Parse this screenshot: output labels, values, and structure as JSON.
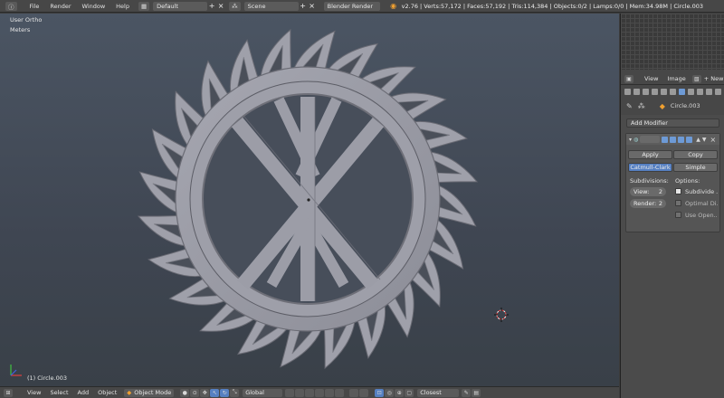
{
  "top_bar": {
    "menus": [
      "File",
      "Render",
      "Window",
      "Help"
    ],
    "screen_layout": "Default",
    "scene": "Scene",
    "render_engine": "Blender Render",
    "stats": "v2.76 | Verts:57,172 | Faces:57,192 | Tris:114,384 | Objects:0/2 | Lamps:0/0 | Mem:34.98M | Circle.003"
  },
  "viewport": {
    "view_name": "User Ortho",
    "units": "Meters",
    "selected_object_label": "(1) Circle.003",
    "axis_labels": {
      "x": "x",
      "y": "y",
      "z": "z"
    }
  },
  "bottom_bar": {
    "menus": [
      "View",
      "Select",
      "Add",
      "Object"
    ],
    "mode": "Object Mode",
    "transform_orientation": "Global",
    "snap_element": "Closest"
  },
  "uv_header": {
    "menus": [
      "View",
      "Image"
    ],
    "new_button": "New"
  },
  "properties": {
    "object_name": "Circle.003",
    "add_modifier": "Add Modifier",
    "modifier": {
      "apply": "Apply",
      "copy": "Copy",
      "type_catmull": "Catmull-Clark",
      "type_simple": "Simple",
      "subdivisions_label": "Subdivisions:",
      "options_label": "Options:",
      "view_label": "View:",
      "view_value": "2",
      "render_label": "Render:",
      "render_value": "2",
      "subdivide_uvs": "Subdivide ...",
      "optimal_display": "Optimal Di...",
      "use_opensubdiv": "Use Open..."
    }
  },
  "colors": {
    "accent": "#5680c2",
    "mesh": "#9b9ca6",
    "viewport_top": "#4b5563"
  }
}
